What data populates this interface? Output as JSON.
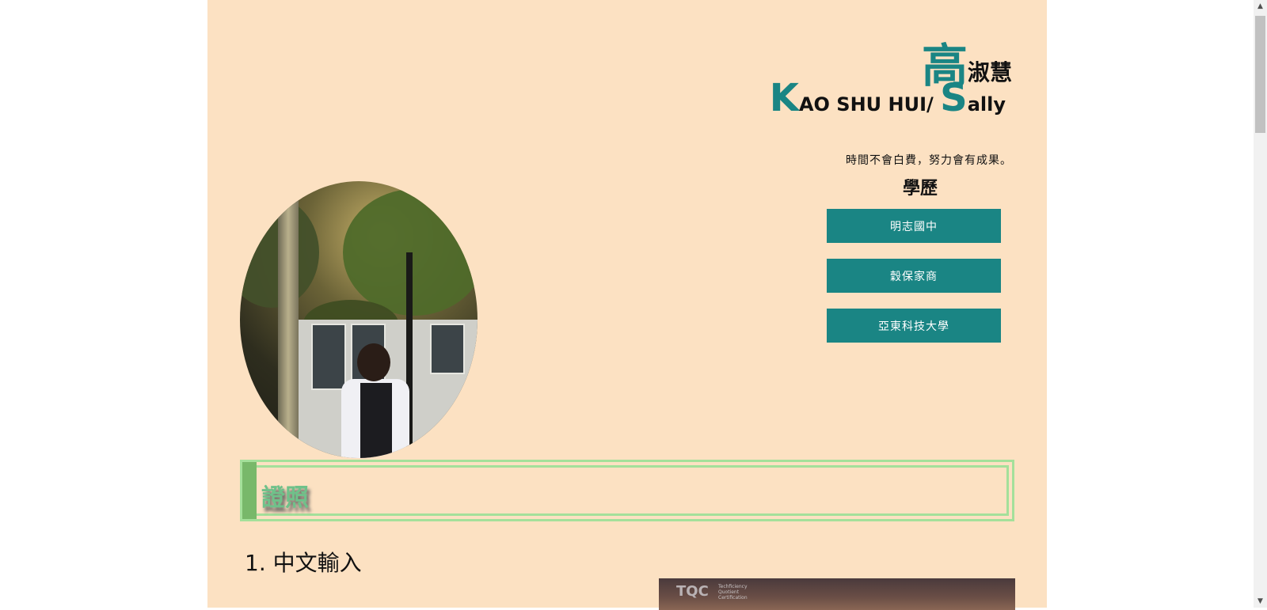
{
  "header": {
    "name_zh_surname": "高",
    "name_zh_given": "淑慧",
    "name_en_first_cap": "K",
    "name_en_rest": "AO SHU HUI/ ",
    "name_en_second_cap": "S",
    "name_en_second_rest": "ally",
    "motto": "時間不會白費，努力會有成果。"
  },
  "education": {
    "title": "學歷",
    "schools": [
      {
        "label": "明志國中"
      },
      {
        "label": "穀保家商"
      },
      {
        "label": "亞東科技大學"
      }
    ]
  },
  "certificates": {
    "section_title": "證照",
    "items": [
      {
        "number": "1.",
        "title": "中文輸入"
      }
    ],
    "image_logo": "TQC",
    "image_logo_sub": "Techficiency Quotient Certification"
  },
  "colors": {
    "page_bg": "#fce1c2",
    "accent_teal": "#1a8584",
    "green_border": "#a4e09a",
    "green_bar": "#78b86a"
  },
  "icons": {
    "scroll_up": "▲",
    "scroll_down": "▼"
  }
}
